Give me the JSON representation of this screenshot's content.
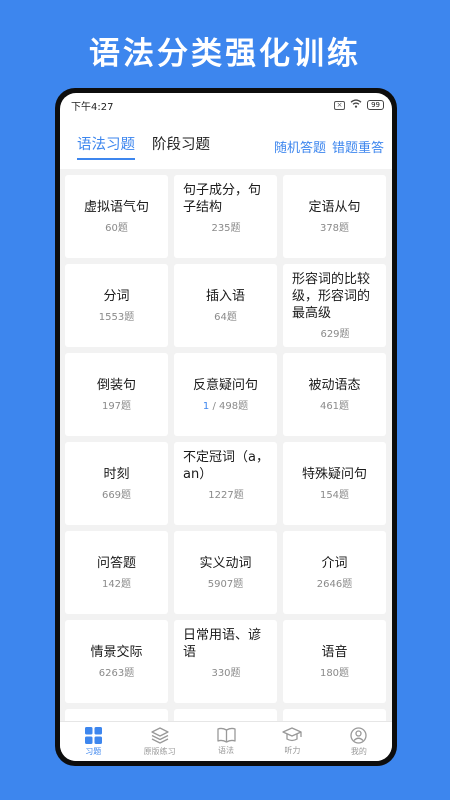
{
  "promo": {
    "title": "语法分类强化训练"
  },
  "status_bar": {
    "time": "下午4:27",
    "battery": "99"
  },
  "tabs": {
    "items": [
      {
        "label": "语法习题",
        "active": true
      },
      {
        "label": "阶段习题",
        "active": false
      }
    ],
    "random_label": "随机答题",
    "wrong_label": "错题重答"
  },
  "grid": [
    {
      "title": "虚拟语气句",
      "count": "60题"
    },
    {
      "title": "句子成分，句子结构",
      "count": "235题"
    },
    {
      "title": "定语从句",
      "count": "378题"
    },
    {
      "title": "分词",
      "count": "1553题"
    },
    {
      "title": "插入语",
      "count": "64题"
    },
    {
      "title": "形容词的比较级，形容词的最高级",
      "count": "629题"
    },
    {
      "title": "倒装句",
      "count": "197题"
    },
    {
      "title": "反意疑问句",
      "done": "1",
      "count": " / 498题"
    },
    {
      "title": "被动语态",
      "count": "461题"
    },
    {
      "title": "时刻",
      "count": "669题"
    },
    {
      "title": "不定冠词（a，an）",
      "count": "1227题"
    },
    {
      "title": "特殊疑问句",
      "count": "154题"
    },
    {
      "title": "问答题",
      "count": "142题"
    },
    {
      "title": "实义动词",
      "count": "5907题"
    },
    {
      "title": "介词",
      "count": "2646题"
    },
    {
      "title": "情景交际",
      "count": "6263题"
    },
    {
      "title": "日常用语、谚语",
      "count": "330题"
    },
    {
      "title": "语音",
      "count": "180题"
    }
  ],
  "bottom_nav": [
    {
      "label": "习题",
      "icon": "grid-icon",
      "active": true
    },
    {
      "label": "原版练习",
      "icon": "layers-icon",
      "active": false
    },
    {
      "label": "语法",
      "icon": "book-icon",
      "active": false
    },
    {
      "label": "听力",
      "icon": "graduation-cap-icon",
      "active": false
    },
    {
      "label": "我的",
      "icon": "profile-icon",
      "active": false
    }
  ],
  "colors": {
    "accent": "#3d86ee",
    "background": "#3d86ee",
    "grid_bg": "#f2f2f2"
  }
}
